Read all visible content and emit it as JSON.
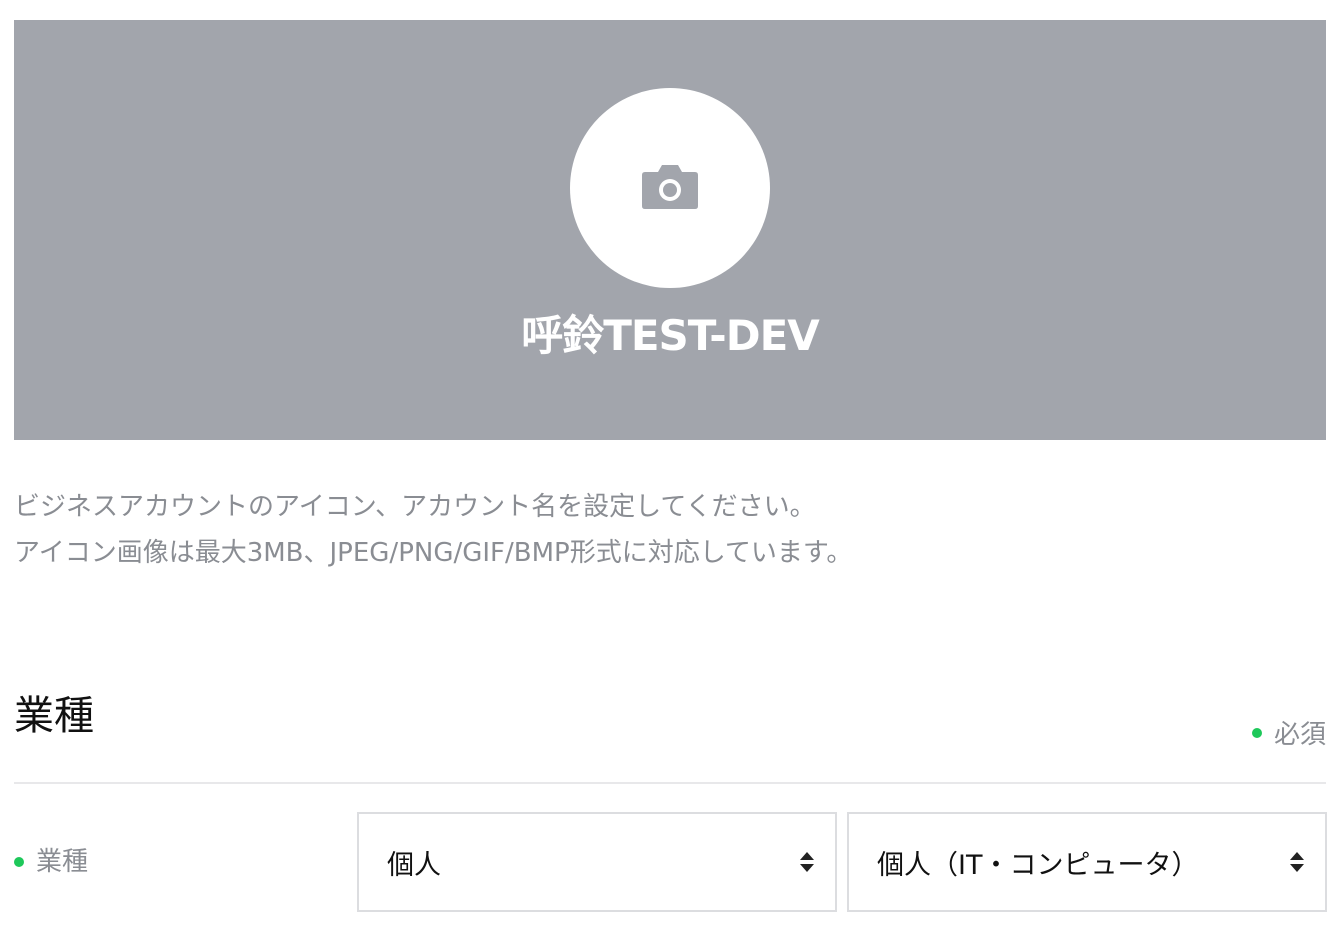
{
  "profile": {
    "account_name": "呼鈴TEST-DEV",
    "upload_icon": "camera-icon",
    "cover_color": "#a2a5ac"
  },
  "description": {
    "line1": "ビジネスアカウントのアイコン、アカウント名を設定してください。",
    "line2": "アイコン画像は最大3MB、JPEG/PNG/GIF/BMP形式に対応しています。"
  },
  "industry_section": {
    "title": "業種",
    "required_label": "必須",
    "required_dot_color": "#1ec85a",
    "field_label": "業種",
    "category_select": {
      "value": "個人"
    },
    "subcategory_select": {
      "value": "個人（IT・コンピュータ）"
    }
  }
}
